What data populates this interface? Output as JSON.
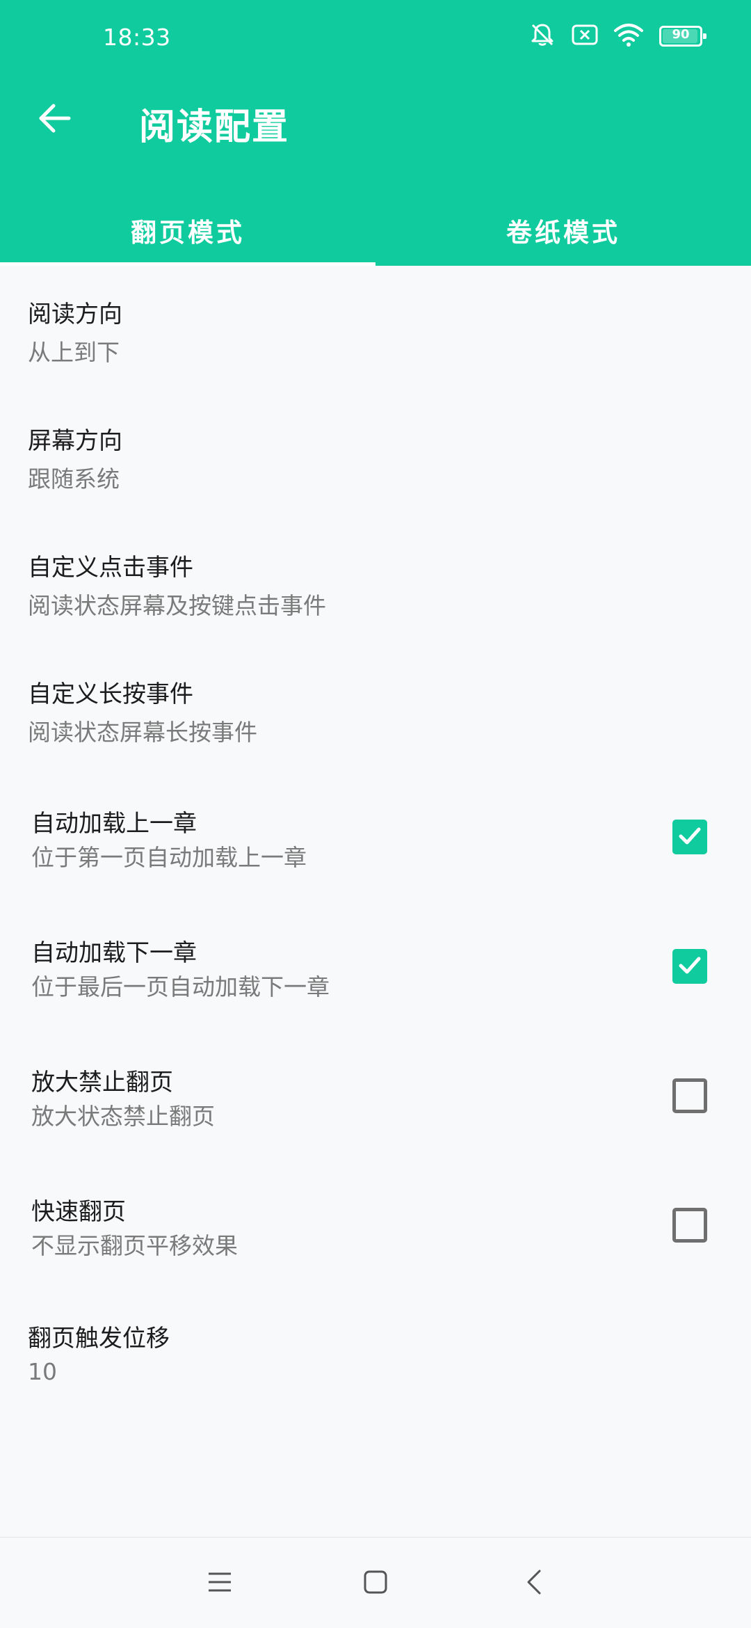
{
  "status_bar": {
    "time": "18:33",
    "battery_level": "90",
    "icons": [
      "bell-muted-icon",
      "sim-x-icon",
      "wifi-icon",
      "battery-icon"
    ]
  },
  "header": {
    "title": "阅读配置",
    "back_icon": "arrow-left-icon",
    "tabs": [
      {
        "label": "翻页模式",
        "selected": true
      },
      {
        "label": "卷纸模式",
        "selected": false
      }
    ]
  },
  "colors": {
    "accent": "#0fcb9d",
    "background": "#f7f9fb",
    "text_primary": "#1c1c1c",
    "text_secondary": "#7a7a7a"
  },
  "settings": [
    {
      "title": "阅读方向",
      "summary": "从上到下"
    },
    {
      "title": "屏幕方向",
      "summary": "跟随系统"
    },
    {
      "title": "自定义点击事件",
      "summary": "阅读状态屏幕及按键点击事件"
    },
    {
      "title": "自定义长按事件",
      "summary": "阅读状态屏幕长按事件"
    },
    {
      "title": "自动加载上一章",
      "summary": "位于第一页自动加载上一章",
      "checked": true
    },
    {
      "title": "自动加载下一章",
      "summary": "位于最后一页自动加载下一章",
      "checked": true
    },
    {
      "title": "放大禁止翻页",
      "summary": "放大状态禁止翻页",
      "checked": false
    },
    {
      "title": "快速翻页",
      "summary": "不显示翻页平移效果",
      "checked": false
    },
    {
      "title": "翻页触发位移",
      "summary": "10"
    }
  ],
  "nav_bar": {
    "icons": [
      "menu-icon",
      "home-square-icon",
      "back-chevron-icon"
    ]
  }
}
